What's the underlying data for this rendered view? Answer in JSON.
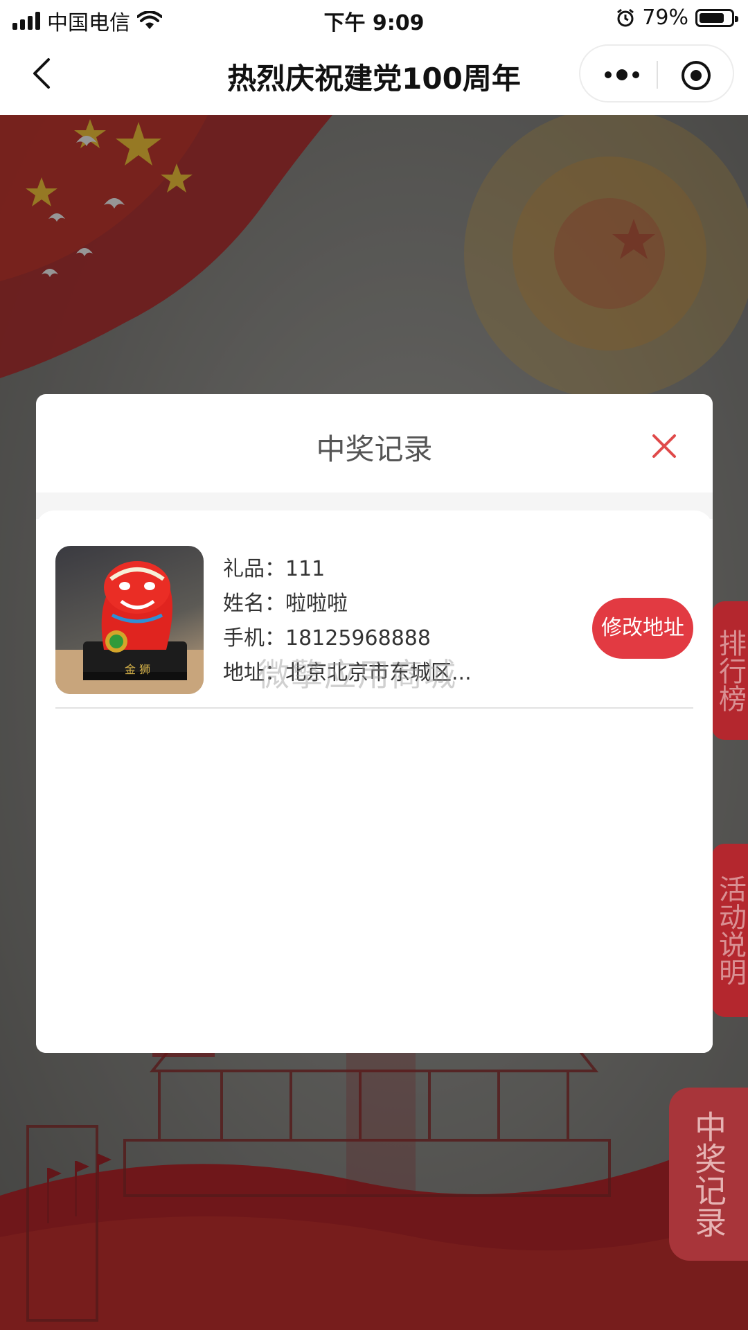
{
  "status_bar": {
    "carrier": "中国电信",
    "time": "下午 9:09",
    "battery": "79%",
    "battery_level": 0.79
  },
  "nav": {
    "title": "热烈庆祝建党100周年"
  },
  "side_tabs": [
    {
      "label": "排行榜"
    },
    {
      "label": "活动说明"
    },
    {
      "label": "中奖记录"
    }
  ],
  "modal": {
    "title": "中奖记录",
    "records": [
      {
        "gift_label": "礼品：",
        "gift": "111",
        "name_label": "姓名：",
        "name": "啦啦啦",
        "phone_label": "手机：",
        "phone": "18125968888",
        "address_label": "地址：",
        "address": "北京北京市东城区...",
        "action": "修改地址"
      }
    ]
  },
  "watermark": "微擎应用商城"
}
